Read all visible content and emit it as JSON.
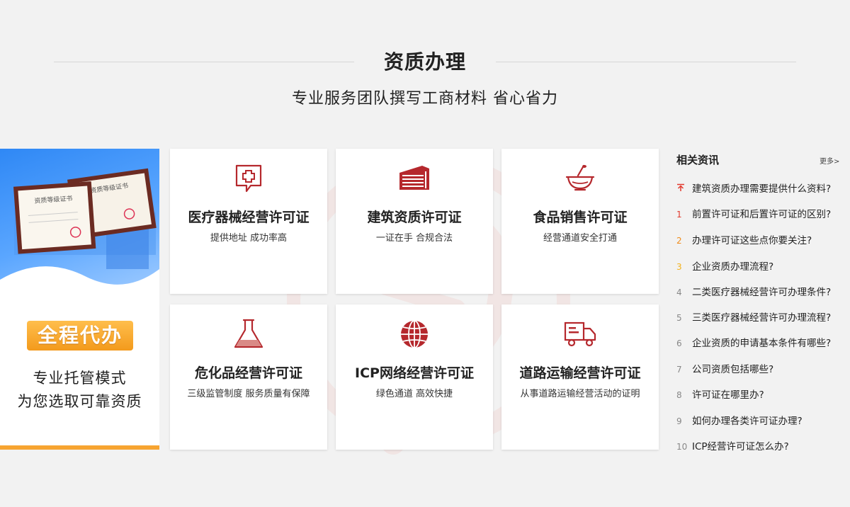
{
  "header": {
    "title": "资质办理",
    "subtitle": "专业服务团队撰写工商材料 省心省力"
  },
  "promo": {
    "cert_back_text": "资质等级证书",
    "cert_front_text": "资质等级证书",
    "badge": "全程代办",
    "line1": "专业托管模式",
    "line2": "为您选取可靠资质",
    "accent_color": "#f7a431"
  },
  "cards": [
    {
      "icon": "medical-cross-icon",
      "title": "医疗器械经营许可证",
      "desc": "提供地址 成功率高"
    },
    {
      "icon": "building-icon",
      "title": "建筑资质许可证",
      "desc": "一证在手 合规合法"
    },
    {
      "icon": "food-bowl-icon",
      "title": "食品销售许可证",
      "desc": "经营通道安全打通"
    },
    {
      "icon": "flask-icon",
      "title": "危化品经营许可证",
      "desc": "三级监管制度  服务质量有保障"
    },
    {
      "icon": "globe-icon",
      "title": "ICP网络经营许可证",
      "desc": "绿色通道  高效快捷"
    },
    {
      "icon": "truck-icon",
      "title": "道路运输经营许可证",
      "desc": "从事道路运输经营活动的证明"
    }
  ],
  "news": {
    "title": "相关资讯",
    "more": "更多>",
    "items": [
      {
        "num": "",
        "text": "建筑资质办理需要提供什么资料?"
      },
      {
        "num": "1",
        "text": "前置许可证和后置许可证的区别?"
      },
      {
        "num": "2",
        "text": "办理许可证这些点你要关注?"
      },
      {
        "num": "3",
        "text": "企业资质办理流程?"
      },
      {
        "num": "4",
        "text": "二类医疗器械经营许可办理条件?"
      },
      {
        "num": "5",
        "text": "三类医疗器械经营许可办理流程?"
      },
      {
        "num": "6",
        "text": "企业资质的申请基本条件有哪些?"
      },
      {
        "num": "7",
        "text": "公司资质包括哪些?"
      },
      {
        "num": "8",
        "text": "许可证在哪里办?"
      },
      {
        "num": "9",
        "text": "如何办理各类许可证办理?"
      },
      {
        "num": "10",
        "text": "ICP经营许可证怎么办?"
      }
    ]
  },
  "colors": {
    "icon_red": "#b5282d",
    "top_red": "#e23a2e"
  }
}
